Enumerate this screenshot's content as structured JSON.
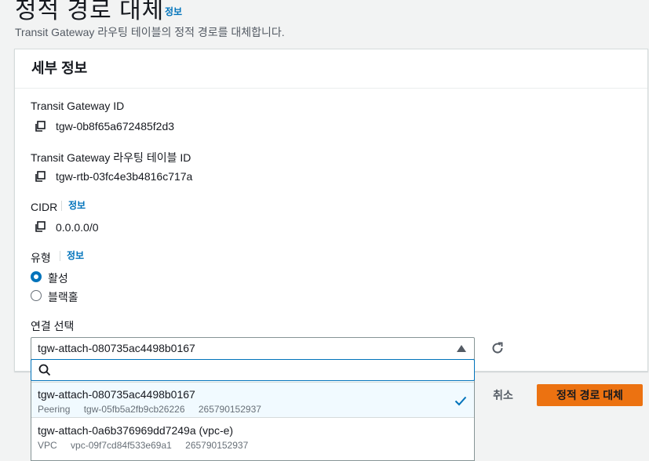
{
  "page": {
    "title": "정적 경로 대체",
    "title_info": "정보",
    "description": "Transit Gateway 라우팅 테이블의 정적 경로를 대체합니다."
  },
  "panel": {
    "title": "세부 정보",
    "tgw_id_label": "Transit Gateway ID",
    "tgw_id_value": "tgw-0b8f65a672485f2d3",
    "rtb_id_label": "Transit Gateway 라우팅 테이블 ID",
    "rtb_id_value": "tgw-rtb-03fc4e3b4816c717a",
    "cidr_label": "CIDR",
    "cidr_info": "정보",
    "cidr_value": "0.0.0.0/0",
    "type_label": "유형",
    "type_info": "정보",
    "type_options": [
      "활성",
      "블랙홀"
    ],
    "type_selected": "활성",
    "attachment_label": "연결 선택",
    "attachment_selected": "tgw-attach-080735ac4498b0167",
    "search_placeholder": ""
  },
  "dropdown": {
    "options": [
      {
        "title": "tgw-attach-080735ac4498b0167",
        "tags": [
          "Peering",
          "tgw-05fb5a2fb9cb26226",
          "265790152937"
        ],
        "selected": true
      },
      {
        "title": "tgw-attach-0a6b376969dd7249a (vpc-e)",
        "tags": [
          "VPC",
          "vpc-09f7cd84f533e69a1",
          "265790152937"
        ],
        "selected": false
      }
    ]
  },
  "actions": {
    "cancel": "취소",
    "submit": "정적 경로 대체"
  },
  "colors": {
    "accent": "#0073bb",
    "primary_button": "#ec7211",
    "selected_option_bg": "#f1faff"
  },
  "icons": [
    "copy-icon",
    "search-icon",
    "refresh-icon",
    "check-icon",
    "caret-up-icon"
  ]
}
